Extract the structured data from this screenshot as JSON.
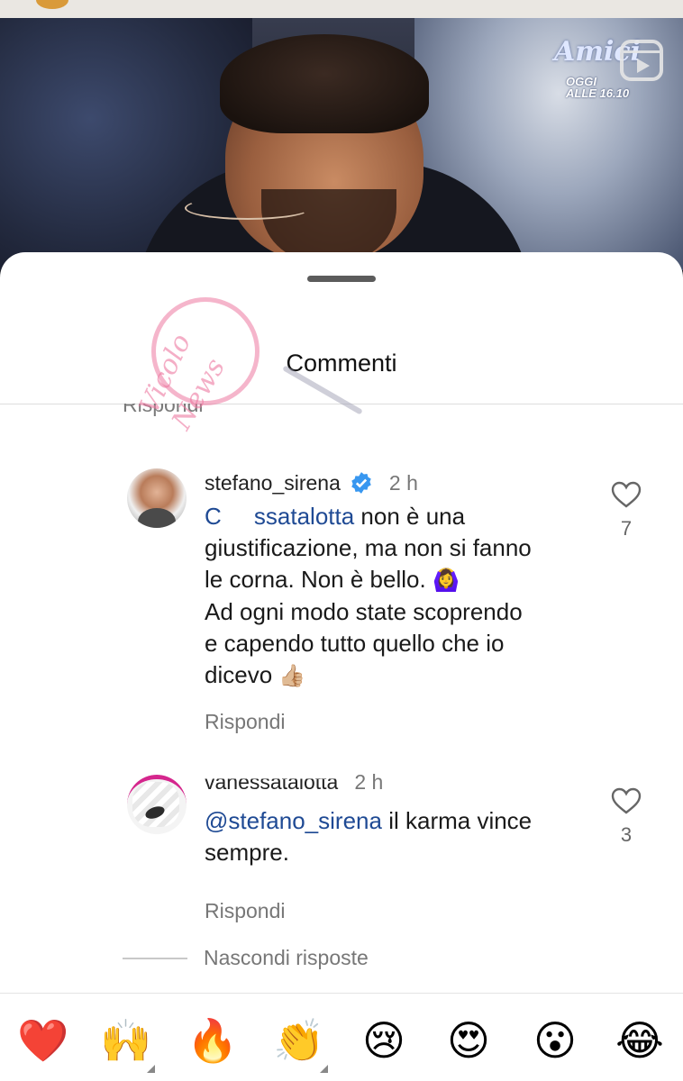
{
  "video": {
    "show_logo": "Amici",
    "show_schedule": "OGGI\nALLE 16.10"
  },
  "sheet": {
    "title": "Commenti"
  },
  "previous_reply_label": "Rispondi",
  "comments": [
    {
      "username": "stefano_sirena",
      "verified": true,
      "time": "2 h",
      "mention": "@vanessatalotta",
      "mention_visible": "C     ssatalotta",
      "text_lines": [
        "non è una",
        "giustificazione, ma non si fanno",
        "le corna. Non è bello.",
        "Ad ogni modo state scoprendo",
        "e capendo tutto quello che io",
        "dicevo"
      ],
      "emoji_after_line3": "🙆‍♀️",
      "emoji_end": "👍🏼",
      "reply_label": "Rispondi",
      "likes": "7"
    },
    {
      "username": "vanessatalotta",
      "verified": false,
      "time": "2 h",
      "mention": "@stefano_sirena",
      "text": "il karma vince",
      "text_line2": "sempre.",
      "reply_label": "Rispondi",
      "likes": "3"
    }
  ],
  "hide_replies_label": "Nascondi risposte",
  "reactions": [
    {
      "emoji": "❤️",
      "icon": "heart"
    },
    {
      "emoji": "🙌",
      "icon": "raising-hands"
    },
    {
      "emoji": "🔥",
      "icon": "fire"
    },
    {
      "emoji": "👏",
      "icon": "clapping-hands"
    },
    {
      "emoji": "😢",
      "icon": "crying-face"
    },
    {
      "emoji": "😍",
      "icon": "heart-eyes"
    },
    {
      "emoji": "😮",
      "icon": "surprised-face"
    },
    {
      "emoji": "😂",
      "icon": "tears-of-joy"
    }
  ],
  "watermark": {
    "text1": "Vicolo",
    "text2": "News"
  },
  "colors": {
    "mention": "#1f4a94",
    "verified": "#3897f0",
    "story_ring": "#d5268d"
  }
}
